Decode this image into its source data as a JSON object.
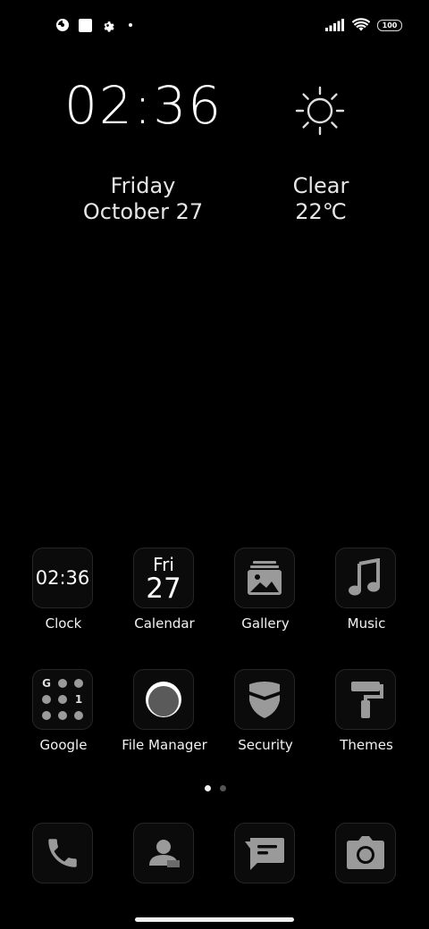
{
  "status": {
    "battery": "100"
  },
  "widget": {
    "time": "02:36",
    "day": "Friday",
    "date": "October 27",
    "weather": "Clear",
    "temp": "22℃"
  },
  "apps": {
    "row1": [
      {
        "label": "Clock",
        "icon": "clock-icon",
        "value": "02:36"
      },
      {
        "label": "Calendar",
        "icon": "calendar-icon",
        "day": "Fri",
        "date": "27"
      },
      {
        "label": "Gallery",
        "icon": "gallery-icon"
      },
      {
        "label": "Music",
        "icon": "music-icon"
      }
    ],
    "row2": [
      {
        "label": "Google",
        "icon": "google-folder-icon",
        "dot_digit": "1",
        "dot_letter": "G"
      },
      {
        "label": "File Manager",
        "icon": "file-manager-icon"
      },
      {
        "label": "Security",
        "icon": "security-icon"
      },
      {
        "label": "Themes",
        "icon": "themes-icon"
      }
    ]
  },
  "dock": [
    "phone-icon",
    "contacts-icon",
    "messages-icon",
    "camera-icon"
  ],
  "pager": {
    "pages": 2,
    "current": 1
  },
  "colors": {
    "background": "#000000",
    "icon_glyph": "#9a9a9a",
    "tile_border": "#262626"
  }
}
